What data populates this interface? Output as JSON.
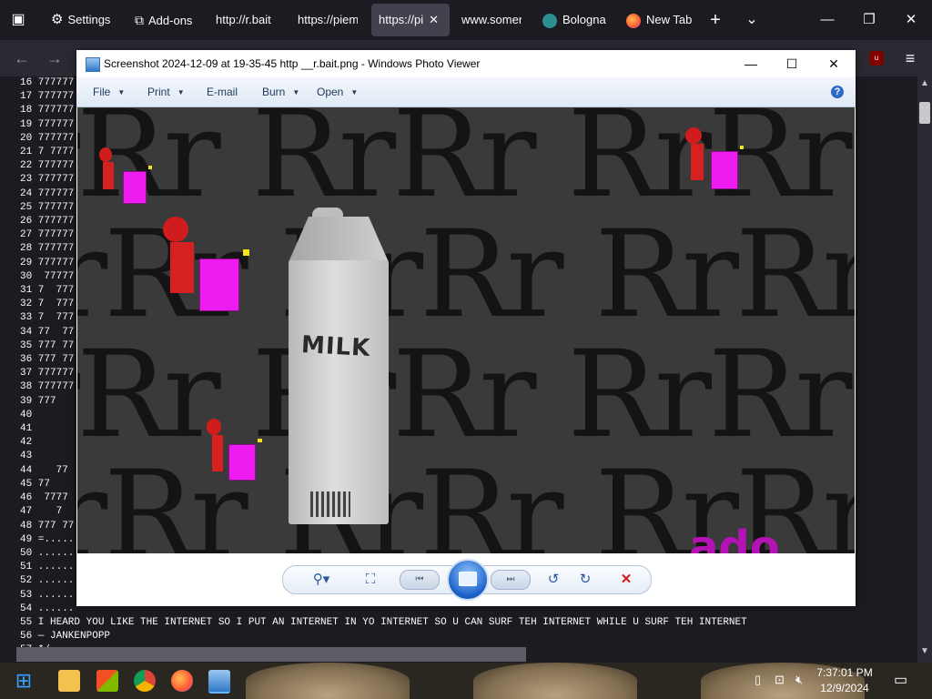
{
  "browser": {
    "tabs": [
      {
        "label": "Settings",
        "icon": "gear-icon"
      },
      {
        "label": "Add-ons",
        "icon": "puzzle-icon"
      },
      {
        "label": "http://r.bait",
        "icon": ""
      },
      {
        "label": "https://piem",
        "icon": ""
      },
      {
        "label": "https://pi",
        "icon": "",
        "active": true
      },
      {
        "label": "www.somer",
        "icon": ""
      },
      {
        "label": "Bologna",
        "icon": "globe-icon"
      },
      {
        "label": "New Tab",
        "icon": "firefox-icon"
      }
    ],
    "new_tab_symbol": "+",
    "list_tabs_symbol": "⌄",
    "window_controls": {
      "minimize": "—",
      "maximize": "❐",
      "close": "✕"
    },
    "menu_symbol": "≡"
  },
  "code_lines": [
    "16 777777",
    "17 777777",
    "18 777777",
    "19 777777",
    "20 777777",
    "21 7 7777",
    "22 777777",
    "23 777777",
    "24 777777",
    "25 777777",
    "26 777777",
    "27 777777",
    "28 777777",
    "29 777777",
    "30  77777",
    "31 7  777",
    "32 7  777",
    "33 7  777",
    "34 77  77",
    "35 777 77",
    "36 777 77",
    "37 777777",
    "38 777777",
    "39 777",
    "40",
    "41",
    "42",
    "43",
    "44    77",
    "45 77",
    "46  7777",
    "47    7",
    "48 777 77",
    "49 =.....",
    "50 ......",
    "51 ......",
    "52 ......",
    "53 ......",
    "54 ......",
    "55 I HEARD YOU LIKE THE INTERNET SO I PUT AN INTERNET IN YO INTERNET SO U CAN SURF TEH INTERNET WHILE U SURF TEH INTERNET",
    "56 — JANKENPOPP",
    "57 */"
  ],
  "viewer": {
    "title": "Screenshot 2024-12-09 at 19-35-45 http __r.bait.png - Windows Photo Viewer",
    "menu": [
      "File",
      "Print",
      "E-mail",
      "Burn",
      "Open"
    ],
    "help_symbol": "?",
    "window_controls": {
      "minimize": "—",
      "maximize": "☐",
      "close": "✕"
    },
    "image": {
      "background_text": "rRr RrRr RrRr R",
      "carton_text": "MILK",
      "corner_text": "ado"
    },
    "toolbar": {
      "zoom_symbol": "⚲▾",
      "fit_symbol": "⛶",
      "prev_symbol": "⏮",
      "next_symbol": "⏭",
      "rotate_ccw_symbol": "↺",
      "rotate_cw_symbol": "↻",
      "delete_symbol": "✕"
    }
  },
  "taskbar": {
    "time": "7:37:01 PM",
    "date": "12/9/2024",
    "start_symbol": "⊞",
    "notification_symbol": "▭"
  },
  "colors": {
    "browser_bg": "#1c1b22",
    "active_tab": "#42414d",
    "viewer_menu": "#dfe9f5",
    "delete_red": "#d01a1a",
    "sprite_magenta": "#ee1cee"
  }
}
